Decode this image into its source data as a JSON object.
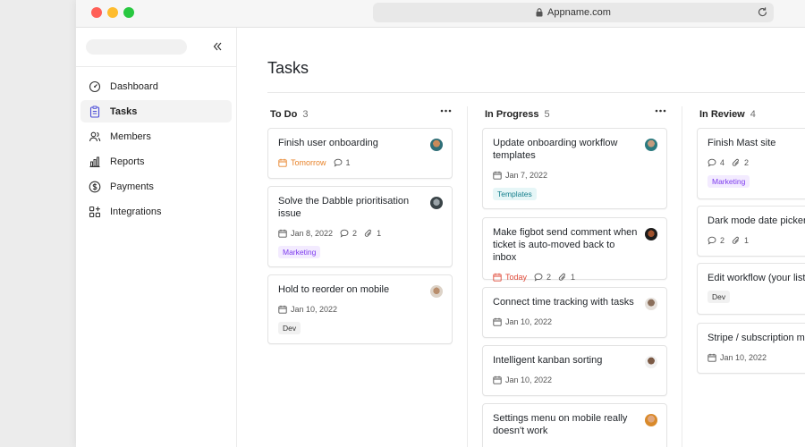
{
  "browser": {
    "url": "Appname.com"
  },
  "sidebar": {
    "items": [
      {
        "label": "Dashboard",
        "icon": "dashboard-icon",
        "active": false
      },
      {
        "label": "Tasks",
        "icon": "clipboard-icon",
        "active": true
      },
      {
        "label": "Members",
        "icon": "users-icon",
        "active": false
      },
      {
        "label": "Reports",
        "icon": "bar-chart-icon",
        "active": false
      },
      {
        "label": "Payments",
        "icon": "dollar-circle-icon",
        "active": false
      },
      {
        "label": "Integrations",
        "icon": "grid-plus-icon",
        "active": false
      }
    ]
  },
  "page": {
    "title": "Tasks"
  },
  "columns": [
    {
      "name": "To Do",
      "count": "3",
      "cards": [
        {
          "title": "Finish user onboarding",
          "due": "Tomorrow",
          "comments": "1"
        },
        {
          "title": "Solve the Dabble prioritisation issue",
          "due": "Jan 8, 2022",
          "comments": "2",
          "attachments": "1",
          "tag": "Marketing"
        },
        {
          "title": "Hold to reorder on mobile",
          "due": "Jan 10, 2022",
          "tag": "Dev"
        }
      ]
    },
    {
      "name": "In Progress",
      "count": "5",
      "cards": [
        {
          "title": "Update onboarding workflow templates",
          "due": "Jan 7, 2022",
          "tag": "Templates"
        },
        {
          "title": "Make figbot send comment when ticket is auto-moved back to inbox",
          "due": "Today",
          "comments": "2",
          "attachments": "1"
        },
        {
          "title": "Connect time tracking with tasks",
          "due": "Jan 10, 2022"
        },
        {
          "title": "Intelligent kanban sorting",
          "due": "Jan 10, 2022"
        },
        {
          "title": "Settings menu on mobile really doesn't work"
        }
      ]
    },
    {
      "name": "In Review",
      "count": "4",
      "cards": [
        {
          "title": "Finish Mast site",
          "comments": "4",
          "attachments": "2",
          "tag": "Marketing"
        },
        {
          "title": "Dark mode date picker",
          "comments": "2",
          "attachments": "1"
        },
        {
          "title": "Edit workflow (your lists",
          "tag": "Dev"
        },
        {
          "title": "Stripe / subscription ma",
          "due": "Jan 10, 2022"
        }
      ]
    }
  ],
  "colors": {
    "accent_orange": "#e8832a",
    "accent_red": "#e04b3a",
    "tag_marketing": "#7c3aed",
    "tag_templates": "#147f8c"
  }
}
